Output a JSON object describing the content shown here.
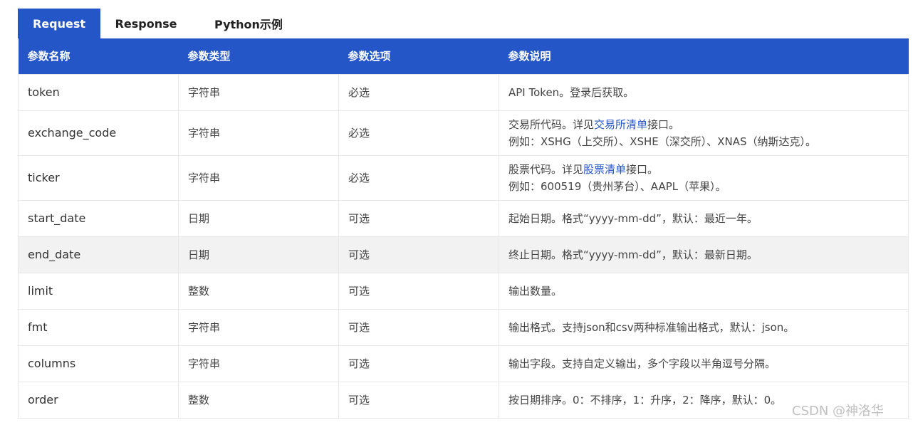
{
  "tabs": [
    {
      "label": "Request",
      "active": true
    },
    {
      "label": "Response",
      "active": false
    },
    {
      "label": "Python示例",
      "active": false
    }
  ],
  "headers": [
    "参数名称",
    "参数类型",
    "参数选项",
    "参数说明"
  ],
  "rows": [
    {
      "name": "token",
      "type": "字符串",
      "option": "必选",
      "desc": "API Token。登录后获取。"
    },
    {
      "name": "exchange_code",
      "type": "字符串",
      "option": "必选",
      "desc_pre": "交易所代码。详见",
      "desc_link": "交易所清单",
      "desc_post": "接口。",
      "desc_line2": "例如：XSHG（上交所）、XSHE（深交所）、XNAS（纳斯达克）。"
    },
    {
      "name": "ticker",
      "type": "字符串",
      "option": "必选",
      "desc_pre": "股票代码。详见",
      "desc_link": "股票清单",
      "desc_post": "接口。",
      "desc_line2": "例如：600519（贵州茅台）、AAPL（苹果）。"
    },
    {
      "name": "start_date",
      "type": "日期",
      "option": "可选",
      "desc": "起始日期。格式“yyyy-mm-dd”，默认：最近一年。"
    },
    {
      "name": "end_date",
      "type": "日期",
      "option": "可选",
      "desc": "终止日期。格式“yyyy-mm-dd”，默认：最新日期。"
    },
    {
      "name": "limit",
      "type": "整数",
      "option": "可选",
      "desc": "输出数量。"
    },
    {
      "name": "fmt",
      "type": "字符串",
      "option": "可选",
      "desc": "输出格式。支持json和csv两种标准输出格式，默认：json。"
    },
    {
      "name": "columns",
      "type": "字符串",
      "option": "可选",
      "desc": "输出字段。支持自定义输出，多个字段以半角逗号分隔。"
    },
    {
      "name": "order",
      "type": "整数",
      "option": "可选",
      "desc": "按日期排序。0：不排序，1：升序，2：降序，默认：0。"
    }
  ],
  "watermark": "CSDN @神洛华",
  "colors": {
    "accent": "#2456c8",
    "highlight_row": "#f2f2f2"
  }
}
